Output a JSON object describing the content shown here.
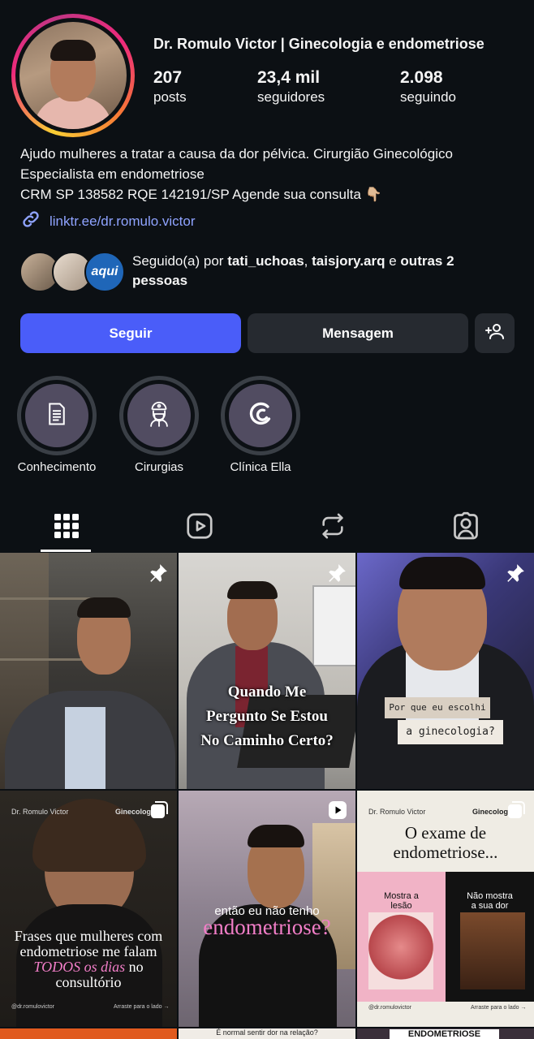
{
  "profile": {
    "name": "Dr. Romulo Victor | Ginecologia e endometriose",
    "stats": [
      {
        "num": "207",
        "label": "posts"
      },
      {
        "num": "23,4 mil",
        "label": "seguidores"
      },
      {
        "num": "2.098",
        "label": "seguindo"
      }
    ],
    "bio_lines": [
      "Ajudo mulheres a tratar a causa da dor pélvica. Cirurgião Ginecológico",
      "Especialista em endometriose",
      "CRM SP 138582 RQE 142191/SP Agende sua consulta 👇🏼"
    ],
    "link": "linktr.ee/dr.romulo.victor"
  },
  "followed_by": {
    "prefix": "Seguido(a) por ",
    "user1": "tati_uchoas",
    "sep": ", ",
    "user2": "taisjory.arq",
    "and": " e ",
    "others": "outras 2",
    "people": "pessoas",
    "third_avatar_text": "aqui"
  },
  "actions": {
    "follow": "Seguir",
    "message": "Mensagem"
  },
  "highlights": [
    {
      "label": "Conhecimento",
      "icon": "document-icon"
    },
    {
      "label": "Cirurgias",
      "icon": "surgeon-icon"
    },
    {
      "label": "Clínica Ella",
      "icon": "clinic-logo-icon"
    }
  ],
  "tabs": [
    "grid-icon",
    "reels-icon",
    "reposts-icon",
    "tagged-icon"
  ],
  "posts": {
    "p2_caption": [
      "Quando Me",
      "Pergunto Se Estou",
      "No Caminho Certo?"
    ],
    "p3_caption": [
      "Por que eu escolhi",
      "a ginecologia?"
    ],
    "p4_top_left": "Dr. Romulo Victor",
    "p4_top_right": "Ginecologia e",
    "p4_caption": [
      "Frases que mulheres com",
      "endometriose me falam"
    ],
    "p4_caption_pink": "TODOS os dias",
    "p4_caption_tail": " no",
    "p4_caption_last": "consultório",
    "p4_handle": "@dr.romulovictor",
    "p4_swipe": "Arraste para o lado →",
    "p5_caption1": "então eu não tenho",
    "p5_caption2": "endometriose?",
    "p6_top_left": "Dr. Romulo Victor",
    "p6_top_right": "Ginecologia e",
    "p6_title": [
      "O exame de",
      "endometriose..."
    ],
    "p6_left_label": [
      "Mostra a",
      "lesão"
    ],
    "p6_right_label": [
      "Não mostra",
      "a sua dor"
    ],
    "p6_handle": "@dr.romulovictor",
    "p6_swipe": "Arraste para o lado →",
    "p8_caption": "É normal sentir dor na relação?",
    "p9_caption": "ENDOMETRIOSE"
  },
  "colors": {
    "accent": "#4a5df9",
    "link": "#8fa3ff",
    "background": "#0c1014",
    "pink": "#f27ec8"
  }
}
